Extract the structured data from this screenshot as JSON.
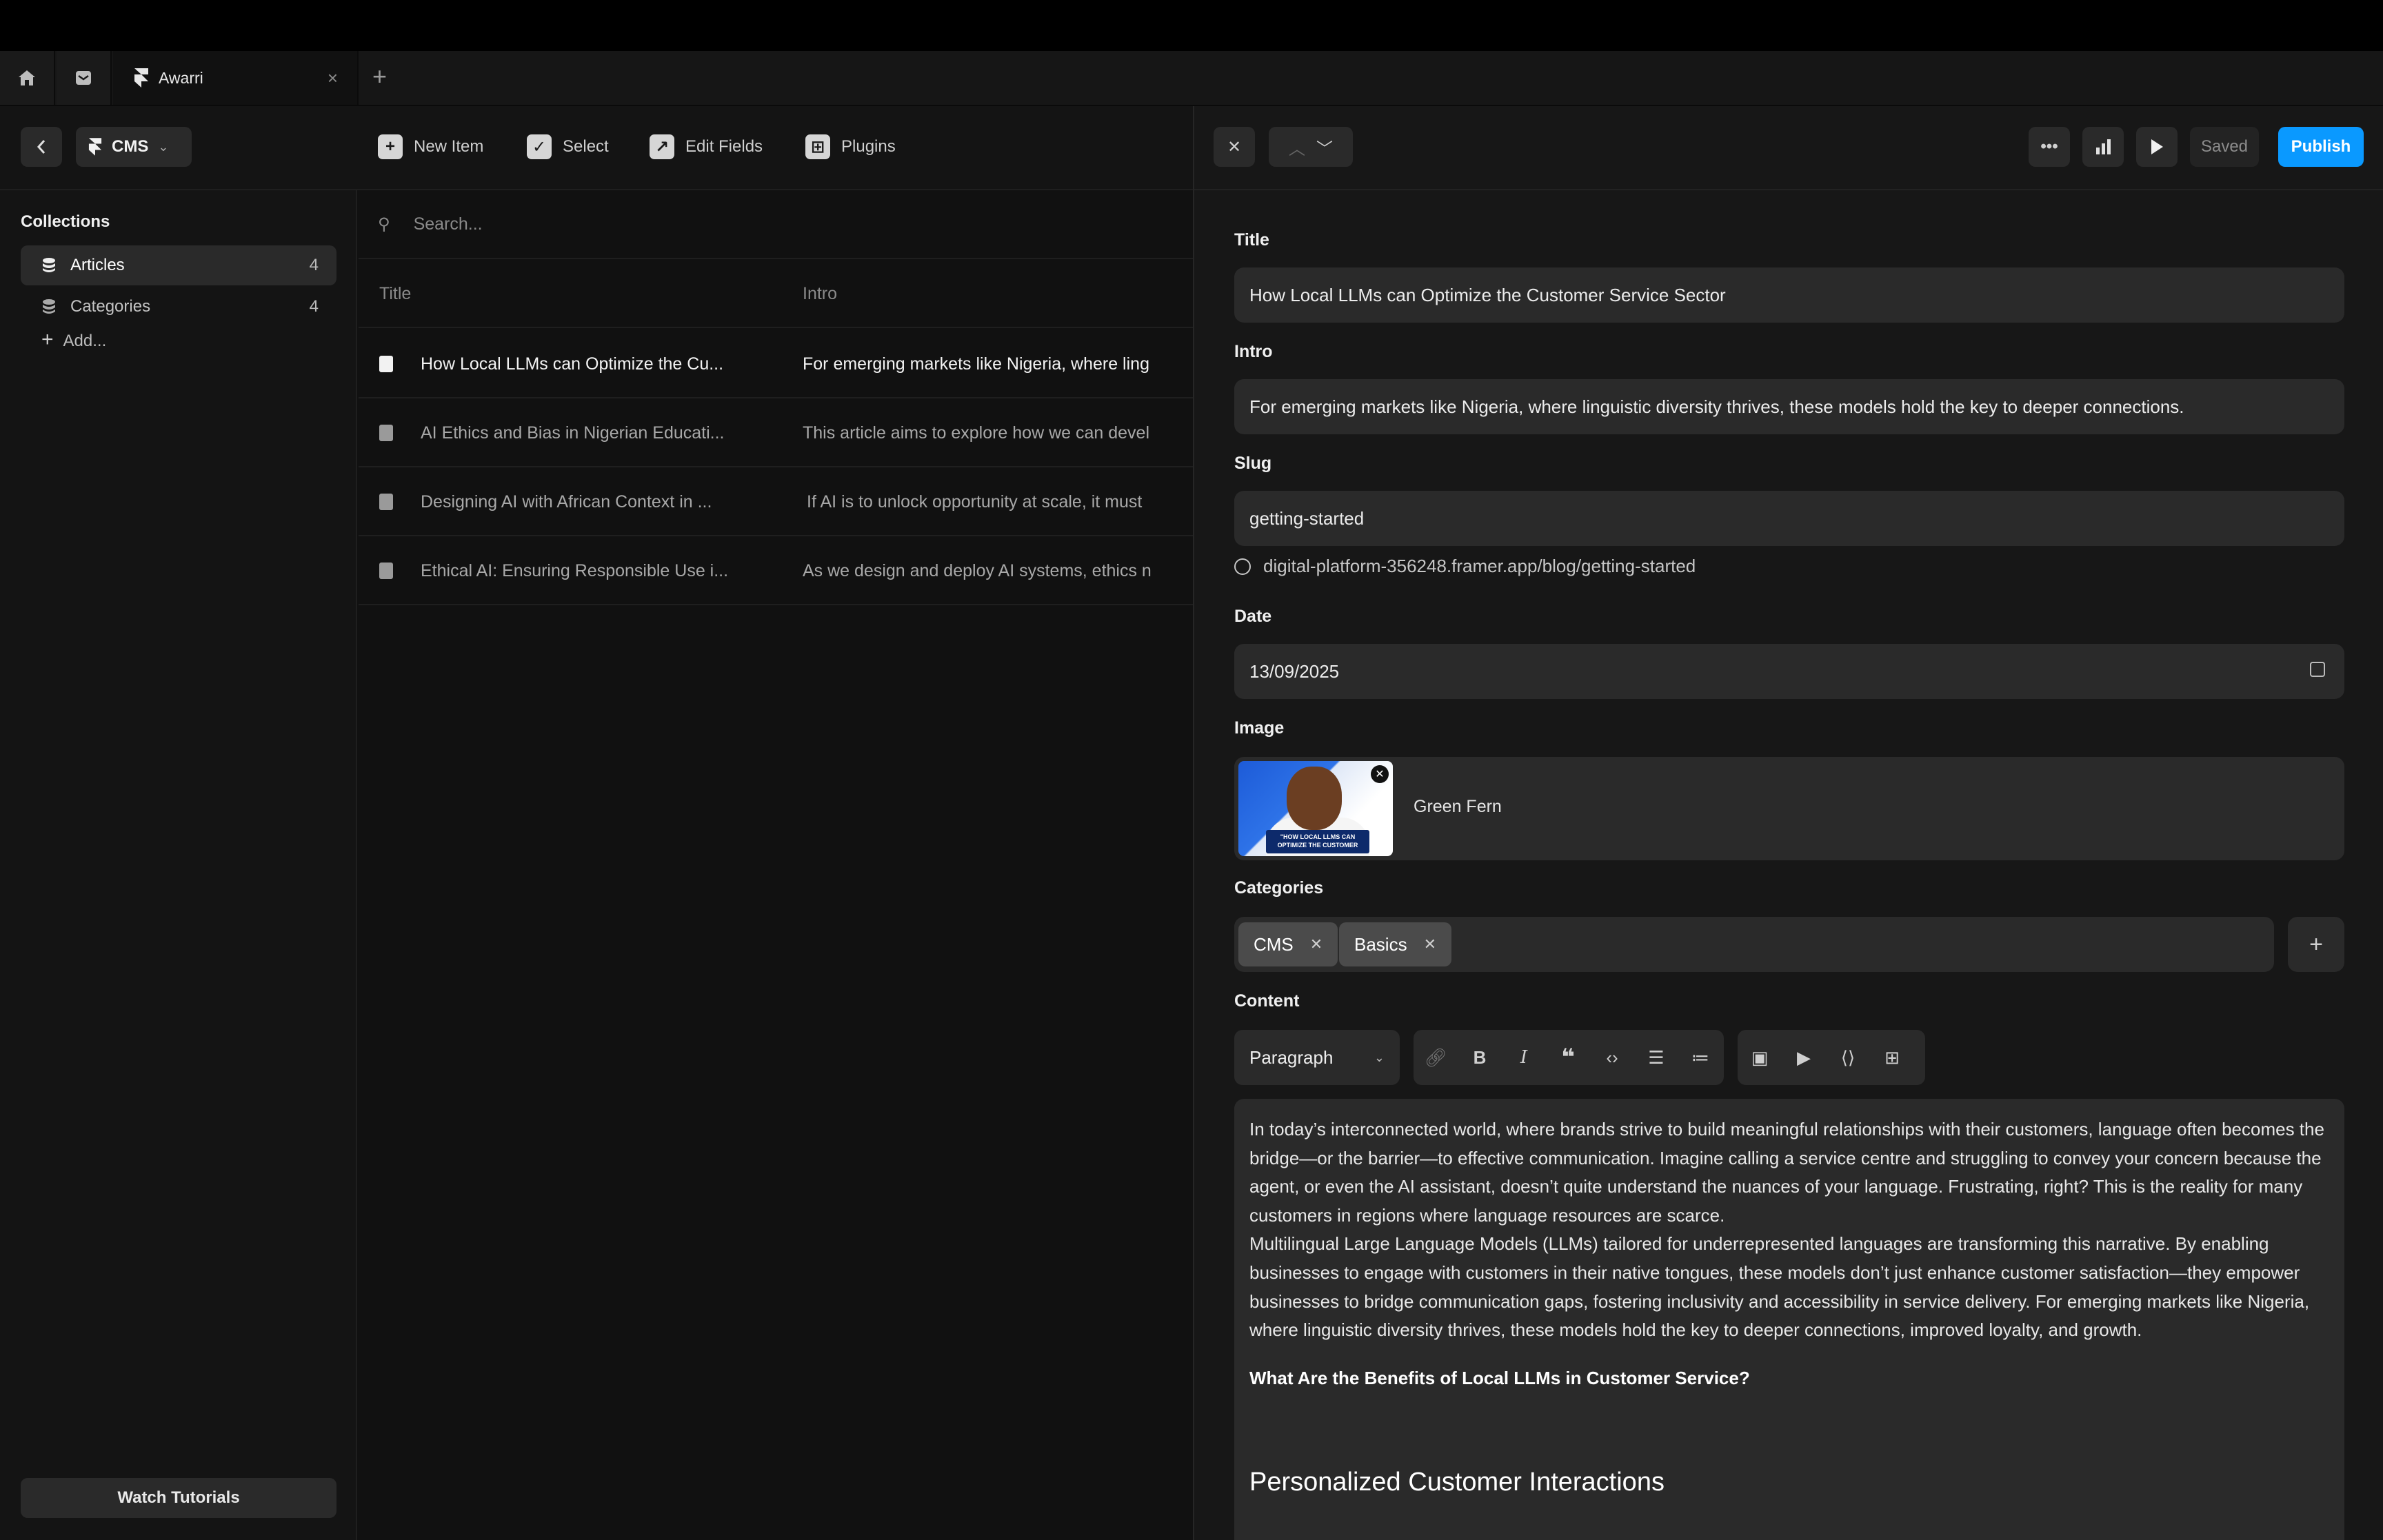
{
  "tabs": {
    "active_title": "Awarri",
    "close_glyph": "×",
    "new_tab_glyph": "+"
  },
  "toolbar": {
    "cms_label": "CMS",
    "new_item": "New Item",
    "select": "Select",
    "edit_fields": "Edit Fields",
    "plugins": "Plugins"
  },
  "sidebar": {
    "heading": "Collections",
    "items": [
      {
        "label": "Articles",
        "count": "4"
      },
      {
        "label": "Categories",
        "count": "4"
      }
    ],
    "add_label": "Add...",
    "watch_tutorials": "Watch Tutorials"
  },
  "list": {
    "search_placeholder": "Search...",
    "col_title": "Title",
    "col_intro": "Intro",
    "rows": [
      {
        "title": "How Local LLMs can Optimize the Cu...",
        "intro": "For emerging markets like Nigeria, where ling"
      },
      {
        "title": "AI Ethics and Bias in Nigerian Educati...",
        "intro": "This article aims to explore how we can devel"
      },
      {
        "title": "Designing AI with African Context in ...",
        "intro": "If AI is to unlock opportunity at scale, it must"
      },
      {
        "title": "Ethical AI: Ensuring Responsible Use i...",
        "intro": "As we design and deploy AI systems, ethics n"
      }
    ]
  },
  "editor": {
    "saved_label": "Saved",
    "publish_label": "Publish",
    "title_label": "Title",
    "title_value": "How Local LLMs can Optimize the Customer Service Sector",
    "intro_label": "Intro",
    "intro_value": "For emerging markets like Nigeria, where linguistic diversity thrives, these models hold the key to deeper connections.",
    "slug_label": "Slug",
    "slug_value": "getting-started",
    "url_value": "digital-platform-356248.framer.app/blog/getting-started",
    "date_label": "Date",
    "date_value": "13/09/2025",
    "image_label": "Image",
    "image_name": "Green Fern",
    "image_caption": "\"HOW LOCAL LLMS CAN OPTIMIZE THE CUSTOMER",
    "categories_label": "Categories",
    "categories": [
      "CMS",
      "Basics"
    ],
    "content_label": "Content",
    "paragraph_style": "Paragraph",
    "content_p1": "In today’s interconnected world, where brands strive to build meaningful relationships with their customers, language often becomes the bridge—or the barrier—to effective communication. Imagine calling a service centre and struggling to convey your concern because the agent, or even the AI assistant, doesn’t quite understand the nuances of your language. Frustrating, right? This is the reality for many customers in regions where language resources are scarce.",
    "content_p2": "Multilingual Large Language Models (LLMs) tailored for underrepresented languages are transforming this narrative. By enabling businesses to engage with customers in their native tongues, these models don’t just enhance customer satisfaction—they empower businesses to bridge communication gaps, fostering inclusivity and accessibility in service delivery. For emerging markets like Nigeria, where linguistic diversity thrives, these models hold the key to deeper connections, improved loyalty, and growth.",
    "content_h": "What Are the Benefits of Local LLMs in Customer Service?",
    "content_h2": "Personalized Customer Interactions"
  },
  "colors": {
    "publish": "#0a99ff",
    "panel": "#2a2a2a",
    "background": "#111111"
  }
}
